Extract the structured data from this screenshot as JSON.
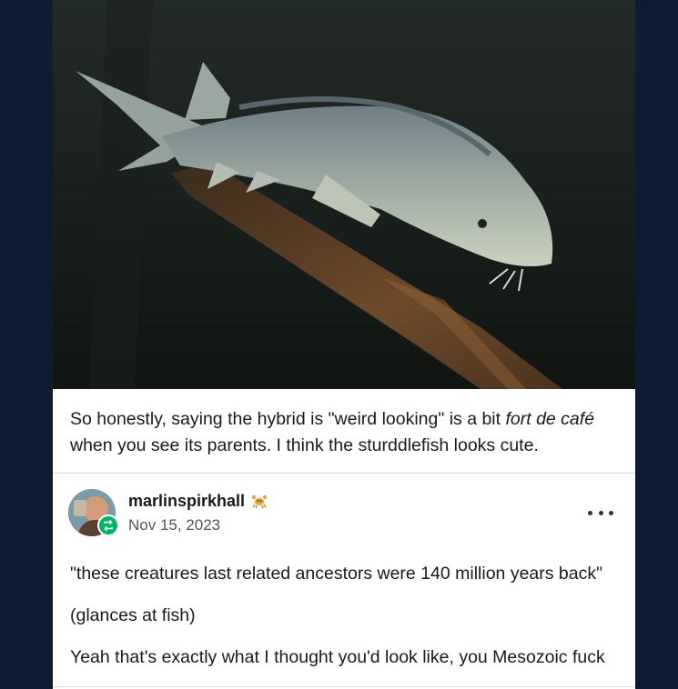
{
  "post": {
    "caption_before": "So honestly, saying the hybrid is \"weird looking\" is a bit ",
    "caption_italic": "fort de café",
    "caption_after": " when you see its parents. I think the sturddlefish looks cute."
  },
  "reblog": {
    "username": "marlinspirkhall",
    "date": "Nov 15, 2023",
    "paragraphs": [
      "\"these creatures last related ancestors were 140 million years back\"",
      "(glances at fish)",
      "Yeah that's exactly what I thought you'd look like, you Mesozoic fuck"
    ]
  },
  "icons": {
    "more": "more-options-icon",
    "reblog": "reblog-icon",
    "badge": "crab-badge-icon"
  },
  "colors": {
    "page_bg": "#0d1b33",
    "reblog_green": "#00b466"
  }
}
